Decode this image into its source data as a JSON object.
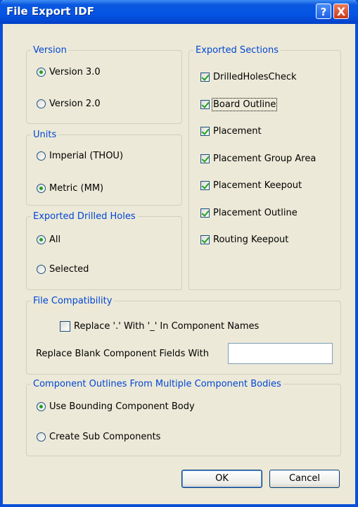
{
  "window": {
    "title": "File Export IDF",
    "help": "?",
    "close": "X"
  },
  "version": {
    "legend": "Version",
    "options": [
      "Version 3.0",
      "Version 2.0"
    ],
    "selected": "Version 3.0"
  },
  "units": {
    "legend": "Units",
    "options": [
      "Imperial (THOU)",
      "Metric (MM)"
    ],
    "selected": "Metric (MM)"
  },
  "drilled": {
    "legend": "Exported Drilled Holes",
    "options": [
      "All",
      "Selected"
    ],
    "selected": "All"
  },
  "sections": {
    "legend": "Exported Sections",
    "items": [
      {
        "label": "DrilledHolesCheck",
        "checked": true
      },
      {
        "label": "Board Outline",
        "checked": true
      },
      {
        "label": "Placement",
        "checked": true
      },
      {
        "label": "Placement Group Area",
        "checked": true
      },
      {
        "label": "Placement Keepout",
        "checked": true
      },
      {
        "label": "Placement Outline",
        "checked": true
      },
      {
        "label": "Routing Keepout",
        "checked": true
      }
    ]
  },
  "compat": {
    "legend": "File Compatibility",
    "replace_dot_label": "Replace '.' With '_' In Component Names",
    "replace_dot_checked": false,
    "blank_label": "Replace Blank Component Fields With",
    "blank_value": ""
  },
  "outlines": {
    "legend": "Component Outlines From Multiple Component Bodies",
    "options": [
      "Use Bounding Component Body",
      "Create Sub Components"
    ],
    "selected": "Use Bounding Component Body"
  },
  "buttons": {
    "ok": "OK",
    "cancel": "Cancel"
  }
}
